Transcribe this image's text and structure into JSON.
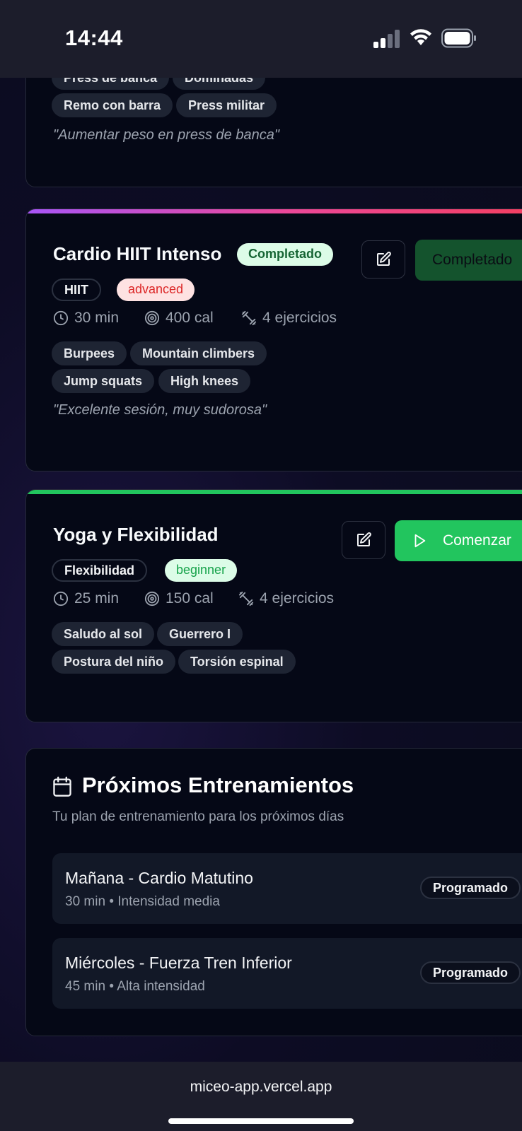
{
  "status_bar": {
    "time": "14:44"
  },
  "prev_card": {
    "tags_top": [
      "Press de banca",
      "Dominadas"
    ],
    "tags": [
      "Remo con barra",
      "Press militar"
    ],
    "note": "\"Aumentar peso en press de banca\""
  },
  "cardio_card": {
    "title": "Cardio HIIT Intenso",
    "status": "Completado",
    "category": "HIIT",
    "level": "advanced",
    "duration": "30 min",
    "calories": "400 cal",
    "exercises": "4 ejercicios",
    "tags": [
      "Burpees",
      "Mountain climbers",
      "Jump squats",
      "High knees"
    ],
    "note": "\"Excelente sesión, muy sudorosa\"",
    "action_label": "Completado",
    "accent": "#a855f7"
  },
  "yoga_card": {
    "title": "Yoga y Flexibilidad",
    "category": "Flexibilidad",
    "level": "beginner",
    "duration": "25 min",
    "calories": "150 cal",
    "exercises": "4 ejercicios",
    "tags": [
      "Saludo al sol",
      "Guerrero I",
      "Postura del niño",
      "Torsión espinal"
    ],
    "action_label": "Comenzar",
    "accent": "#22c55e"
  },
  "upcoming": {
    "title": "Próximos Entrenamientos",
    "subtitle": "Tu plan de entrenamiento para los próximos días",
    "items": [
      {
        "name": "Mañana - Cardio Matutino",
        "duration": "30 min",
        "intensity": "Intensidad media",
        "status": "Programado"
      },
      {
        "name": "Miércoles - Fuerza Tren Inferior",
        "duration": "45 min",
        "intensity": "Alta intensidad",
        "status": "Programado"
      }
    ]
  },
  "browser": {
    "url": "miceo-app.vercel.app"
  }
}
